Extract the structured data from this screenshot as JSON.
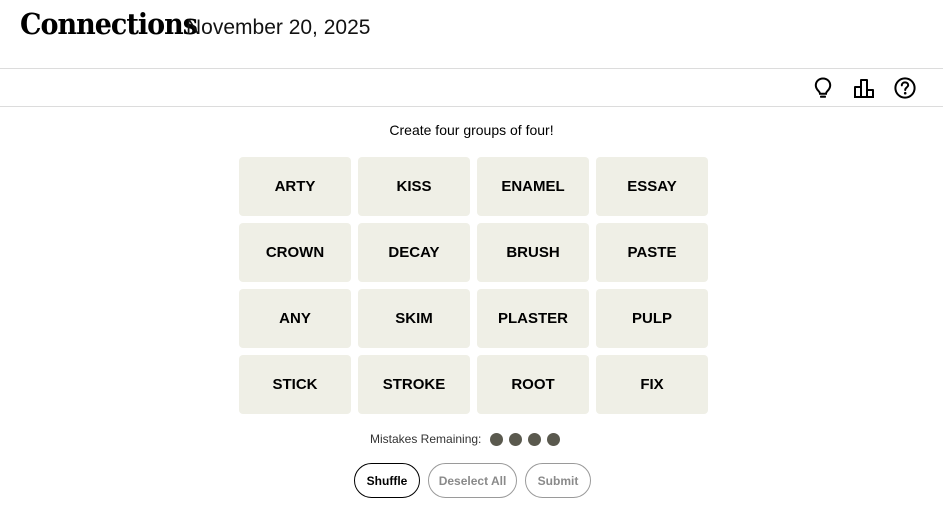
{
  "header": {
    "title": "Connections",
    "date": "November 20, 2025"
  },
  "toolbar": {
    "icons": [
      "lightbulb-icon",
      "leaderboard-icon",
      "help-icon"
    ]
  },
  "game": {
    "instructions": "Create four groups of four!",
    "tiles": [
      "ARTY",
      "KISS",
      "ENAMEL",
      "ESSAY",
      "CROWN",
      "DECAY",
      "BRUSH",
      "PASTE",
      "ANY",
      "SKIM",
      "PLASTER",
      "PULP",
      "STICK",
      "STROKE",
      "ROOT",
      "FIX"
    ],
    "mistakes_label": "Mistakes Remaining:",
    "mistakes_remaining": 4
  },
  "actions": {
    "shuffle_label": "Shuffle",
    "deselect_label": "Deselect All",
    "submit_label": "Submit"
  },
  "colors": {
    "tile_background": "#efefe6",
    "mistake_dot": "#5a594e",
    "border": "#dcdcdc"
  }
}
